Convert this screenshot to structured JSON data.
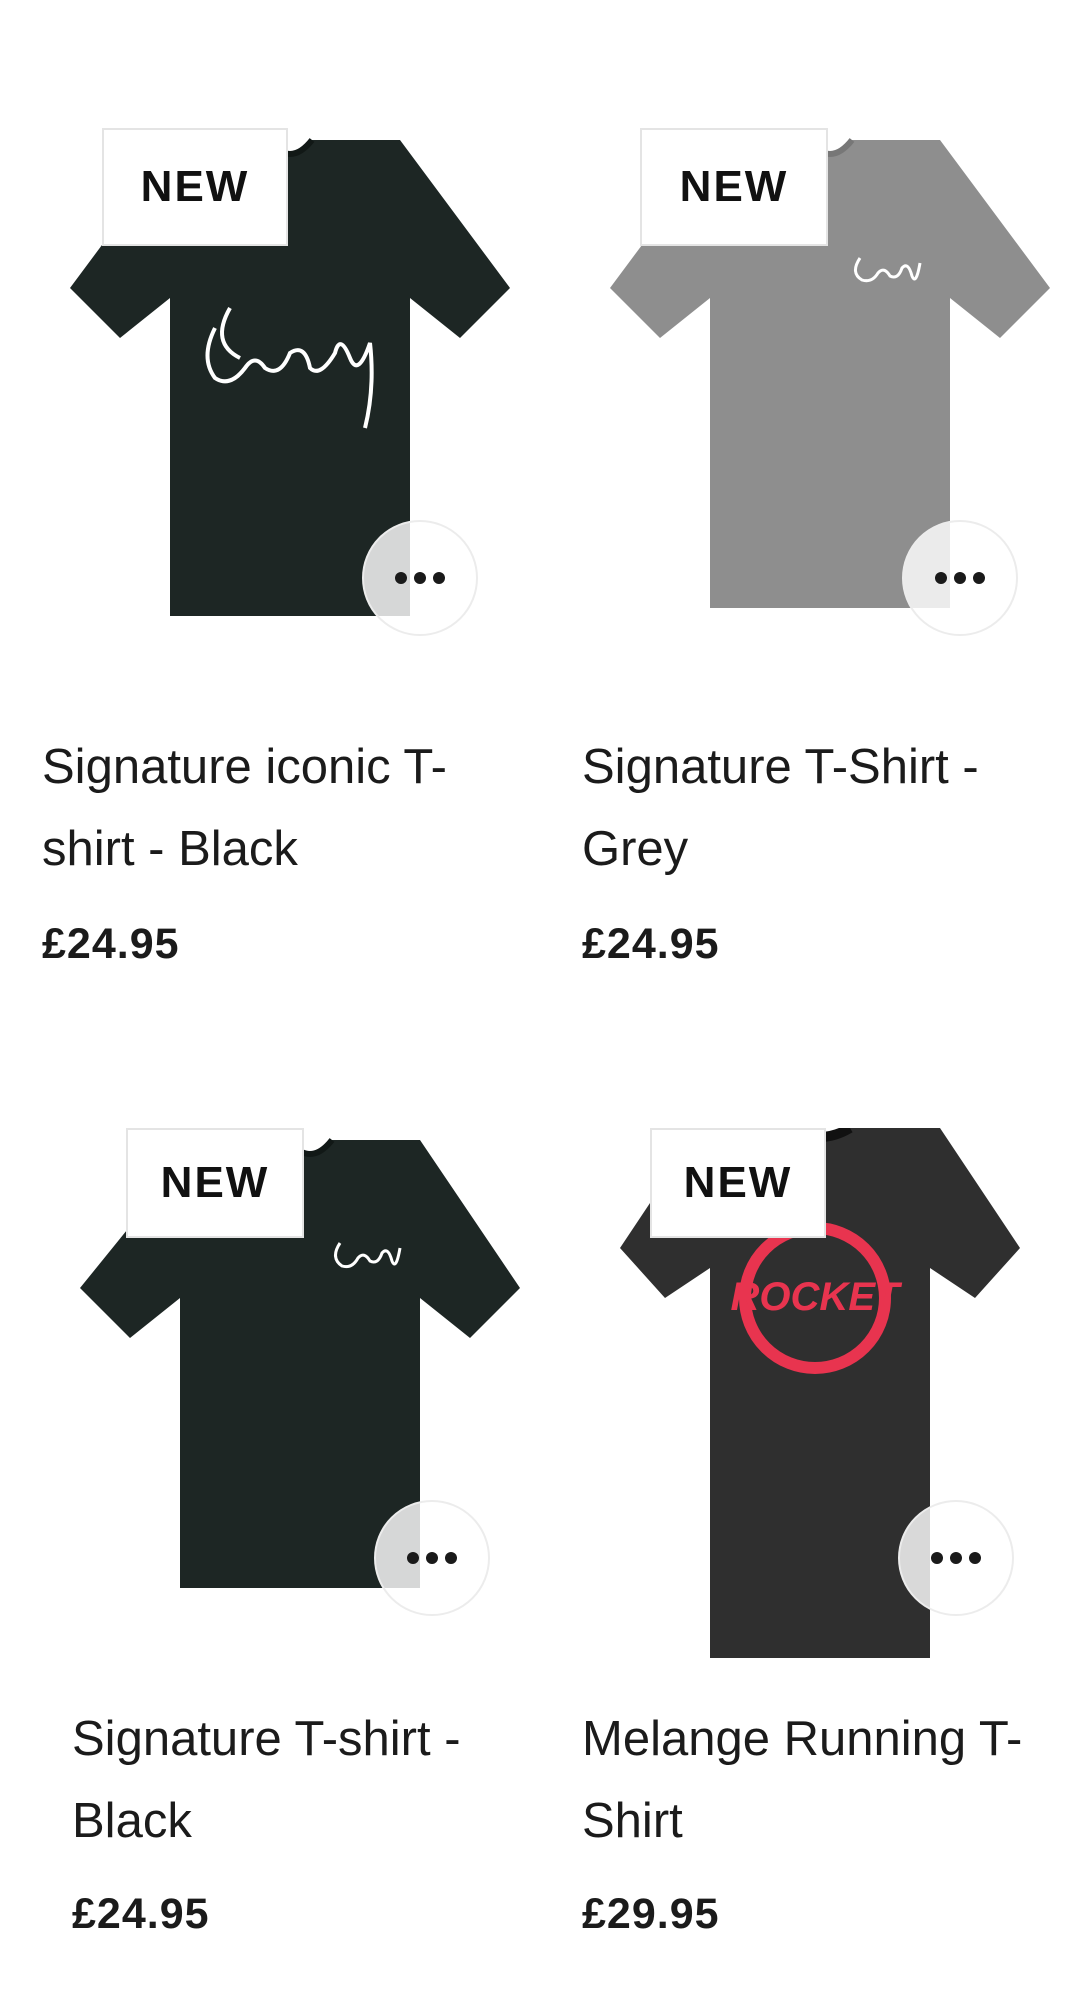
{
  "products": [
    {
      "badge": "NEW",
      "title": "Signature iconic T-shirt - Black",
      "price": "£24.95",
      "shirt_color": "#1d2624",
      "print": "signature-large"
    },
    {
      "badge": "NEW",
      "title": "Signature T-Shirt - Grey",
      "price": "£24.95",
      "shirt_color": "#8e8e8e",
      "print": "signature-small"
    },
    {
      "badge": "NEW",
      "title": "Signature T-shirt - Black",
      "price": "£24.95",
      "shirt_color": "#1d2624",
      "print": "signature-small"
    },
    {
      "badge": "NEW",
      "title": "Melange Running T-Shirt",
      "price": "£29.95",
      "shirt_color": "#2f2f2f",
      "print": "rocket-logo"
    }
  ],
  "more_icon": "more-horizontal-icon",
  "colors": {
    "badge_border": "#e4e4e4",
    "rocket_red": "#e8344f"
  }
}
